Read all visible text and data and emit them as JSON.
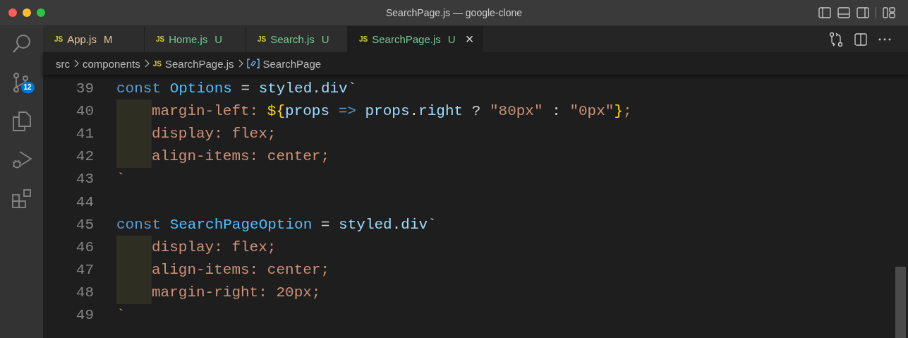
{
  "window": {
    "title": "SearchPage.js — google-clone"
  },
  "activity_bar": {
    "source_control_badge": "12"
  },
  "tabs": [
    {
      "icon": "JS",
      "label": "App.js",
      "status": "M",
      "color": "#e2c08d",
      "selected": false
    },
    {
      "icon": "JS",
      "label": "Home.js",
      "status": "U",
      "color": "#73c991",
      "selected": false
    },
    {
      "icon": "JS",
      "label": "Search.js",
      "status": "U",
      "color": "#73c991",
      "selected": false
    },
    {
      "icon": "JS",
      "label": "SearchPage.js",
      "status": "U",
      "color": "#73c991",
      "selected": true
    }
  ],
  "close_tab": "×",
  "breadcrumbs": [
    {
      "kind": "folder",
      "label": "src"
    },
    {
      "kind": "folder",
      "label": "components"
    },
    {
      "kind": "file",
      "icon": "JS",
      "label": "SearchPage.js"
    },
    {
      "kind": "symbol",
      "label": "SearchPage"
    }
  ],
  "code": [
    {
      "number": "39",
      "indented": false,
      "tokens": [
        {
          "kind": "keyword",
          "text": "const "
        },
        {
          "kind": "const",
          "text": "Options"
        },
        {
          "kind": "plain",
          "text": " = "
        },
        {
          "kind": "var",
          "text": "styled"
        },
        {
          "kind": "plain",
          "text": "."
        },
        {
          "kind": "var",
          "text": "div"
        },
        {
          "kind": "plain",
          "text": "`"
        }
      ]
    },
    {
      "number": "40",
      "indented": true,
      "tokens": [
        {
          "kind": "css",
          "text": "margin-left: "
        },
        {
          "kind": "bracket",
          "text": "${"
        },
        {
          "kind": "var",
          "text": "props "
        },
        {
          "kind": "keyword",
          "text": "=> "
        },
        {
          "kind": "var",
          "text": "props"
        },
        {
          "kind": "plain",
          "text": "."
        },
        {
          "kind": "var",
          "text": "right"
        },
        {
          "kind": "plain",
          "text": " ? "
        },
        {
          "kind": "css",
          "text": "\"80px\""
        },
        {
          "kind": "plain",
          "text": " : "
        },
        {
          "kind": "css",
          "text": "\"0px\""
        },
        {
          "kind": "bracket",
          "text": "}"
        },
        {
          "kind": "css",
          "text": ";"
        }
      ]
    },
    {
      "number": "41",
      "indented": true,
      "tokens": [
        {
          "kind": "css",
          "text": "display: flex;"
        }
      ]
    },
    {
      "number": "42",
      "indented": true,
      "tokens": [
        {
          "kind": "css",
          "text": "align-items: center;"
        }
      ]
    },
    {
      "number": "43",
      "indented": false,
      "tokens": [
        {
          "kind": "css",
          "text": "`"
        }
      ]
    },
    {
      "number": "44",
      "indented": false
    },
    {
      "number": "45",
      "indented": false,
      "tokens": [
        {
          "kind": "keyword",
          "text": "const "
        },
        {
          "kind": "const",
          "text": "SearchPageOption"
        },
        {
          "kind": "plain",
          "text": " = "
        },
        {
          "kind": "var",
          "text": "styled"
        },
        {
          "kind": "plain",
          "text": "."
        },
        {
          "kind": "var",
          "text": "div"
        },
        {
          "kind": "plain",
          "text": "`"
        }
      ]
    },
    {
      "number": "46",
      "indented": true,
      "tokens": [
        {
          "kind": "css",
          "text": "display: flex;"
        }
      ]
    },
    {
      "number": "47",
      "indented": true,
      "tokens": [
        {
          "kind": "css",
          "text": "align-items: center;"
        }
      ]
    },
    {
      "number": "48",
      "indented": true,
      "tokens": [
        {
          "kind": "css",
          "text": "margin-right: 20px;"
        }
      ]
    },
    {
      "number": "49",
      "indented": false,
      "tokens": [
        {
          "kind": "css",
          "text": "`"
        }
      ]
    }
  ]
}
